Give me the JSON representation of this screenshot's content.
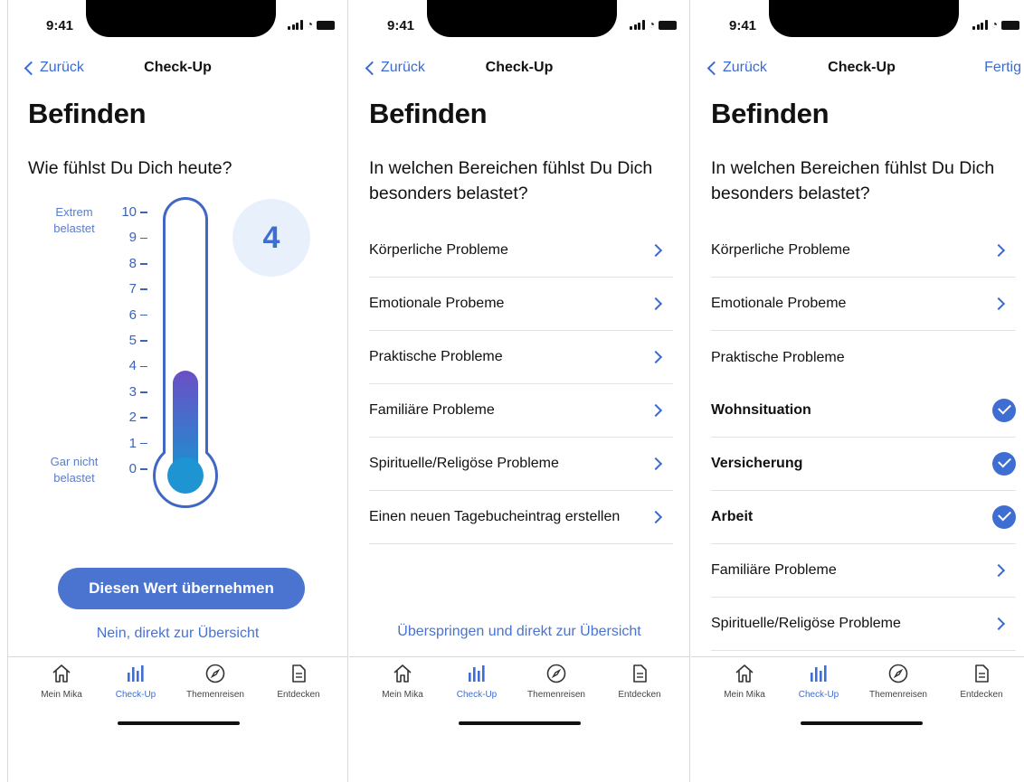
{
  "status": {
    "time": "9:41"
  },
  "screens": [
    {
      "nav": {
        "back": "Zurück",
        "title": "Check-Up",
        "done": ""
      },
      "title": "Befinden",
      "question": "Wie fühlst Du Dich heute?",
      "thermometer": {
        "top_label": "Extrem belastet",
        "bottom_label": "Gar nicht belastet",
        "ticks": [
          "10",
          "9",
          "8",
          "7",
          "6",
          "5",
          "4",
          "3",
          "2",
          "1",
          "0"
        ],
        "value": "4",
        "level": 0.4,
        "gradient": [
          "#6b4fc6",
          "#1f8ed0"
        ]
      },
      "primary_button": "Diesen Wert übernehmen",
      "secondary_link": "Nein, direkt zur Übersicht"
    },
    {
      "nav": {
        "back": "Zurück",
        "title": "Check-Up",
        "done": ""
      },
      "title": "Befinden",
      "question": "In welchen Bereichen fühlst Du Dich besonders belastet?",
      "items": [
        "Körperliche Probleme",
        "Emotionale Probeme",
        "Praktische Probleme",
        "Familiäre Probleme",
        "Spirituelle/Religöse Probleme",
        "Einen neuen Tagebucheintrag erstellen"
      ],
      "skip_link": "Überspringen und direkt zur Übersicht"
    },
    {
      "nav": {
        "back": "Zurück",
        "title": "Check-Up",
        "done": "Fertig"
      },
      "title": "Befinden",
      "question": "In welchen Bereichen fühlst Du Dich besonders belastet?",
      "items": [
        {
          "label": "Körperliche Probleme",
          "type": "chevron"
        },
        {
          "label": "Emotionale Probeme",
          "type": "chevron"
        },
        {
          "label": "Praktische Probleme",
          "type": "none"
        },
        {
          "label": "Wohnsituation",
          "type": "check",
          "checked": true
        },
        {
          "label": "Versicherung",
          "type": "check",
          "checked": true
        },
        {
          "label": "Arbeit",
          "type": "check",
          "checked": true
        },
        {
          "label": "Familiäre Probleme",
          "type": "chevron"
        },
        {
          "label": "Spirituelle/Religöse Probleme",
          "type": "chevron"
        }
      ]
    }
  ],
  "tabs": [
    {
      "label": "Mein Mika",
      "icon": "home-icon",
      "active": false
    },
    {
      "label": "Check-Up",
      "icon": "bar-chart-icon",
      "active": true
    },
    {
      "label": "Themenreisen",
      "icon": "compass-icon",
      "active": false
    },
    {
      "label": "Entdecken",
      "icon": "document-icon",
      "active": false
    }
  ],
  "colors": {
    "accent": "#3e6ed1",
    "button": "#4a74cf",
    "value_bg": "#e8f0fb"
  }
}
